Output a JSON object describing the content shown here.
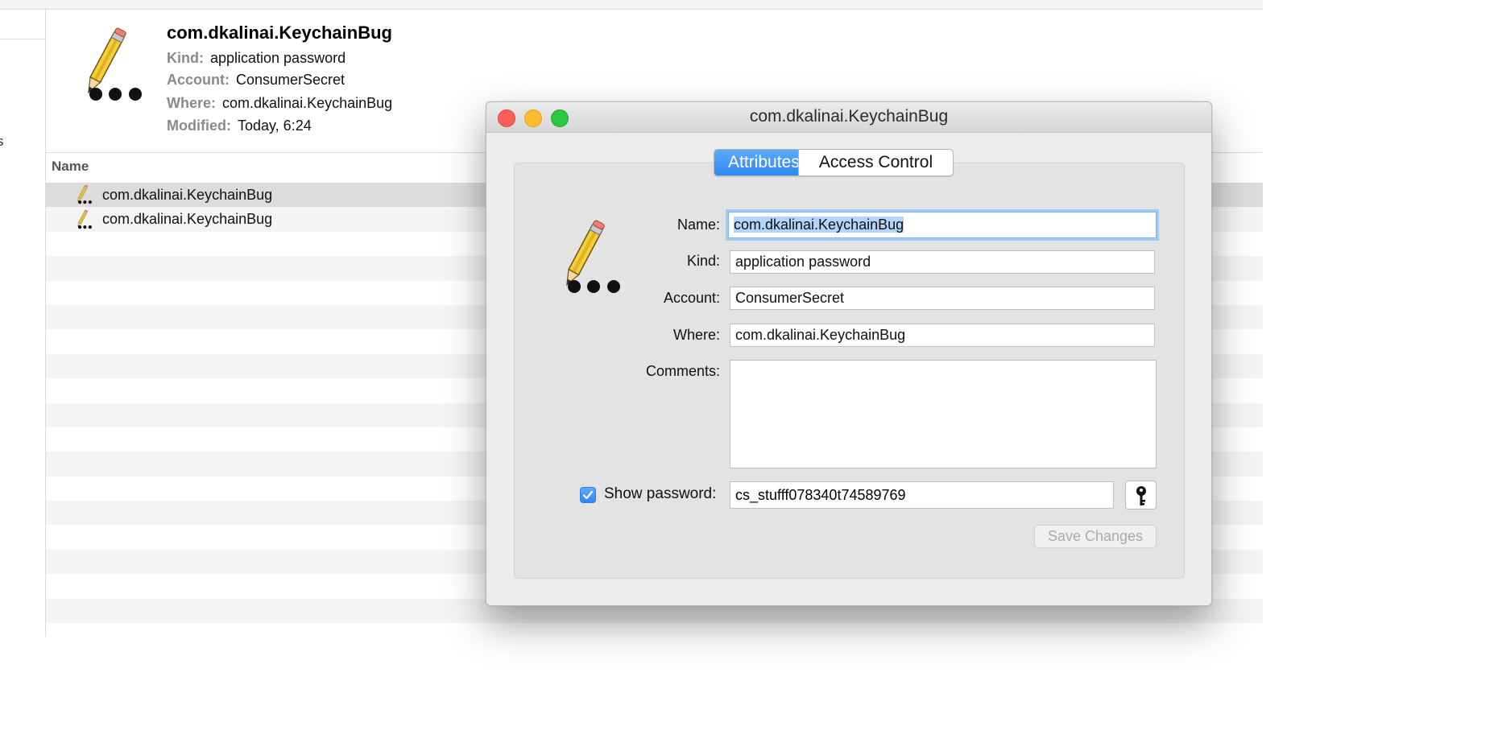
{
  "background": {
    "summary": {
      "title": "com.dkalinai.KeychainBug",
      "kind_label": "Kind:",
      "kind_value": "application password",
      "account_label": "Account:",
      "account_value": "ConsumerSecret",
      "where_label": "Where:",
      "where_value": "com.dkalinai.KeychainBug",
      "modified_label": "Modified:",
      "modified_value": "Today, 6:24"
    },
    "sidebar_partial_text": "s",
    "list": {
      "column_header": "Name",
      "rows": [
        {
          "name": "com.dkalinai.KeychainBug",
          "selected": true
        },
        {
          "name": "com.dkalinai.KeychainBug",
          "selected": false
        }
      ]
    }
  },
  "dialog": {
    "title": "com.dkalinai.KeychainBug",
    "tabs": [
      {
        "label": "Attributes",
        "active": true
      },
      {
        "label": "Access Control",
        "active": false
      }
    ],
    "form": {
      "name_label": "Name:",
      "name_value": "com.dkalinai.KeychainBug",
      "kind_label": "Kind:",
      "kind_value": "application password",
      "account_label": "Account:",
      "account_value": "ConsumerSecret",
      "where_label": "Where:",
      "where_value": "com.dkalinai.KeychainBug",
      "comments_label": "Comments:",
      "comments_value": "",
      "show_password_label": "Show password:",
      "show_password_checked": true,
      "password_value": "cs_stufff078340t74589769"
    },
    "key_button_icon": "key-icon",
    "save_label": "Save Changes",
    "save_enabled": false
  },
  "icons": {
    "item_icon": "pencil-password-icon",
    "close": "close-traffic-light",
    "minimize": "minimize-traffic-light",
    "zoom": "zoom-traffic-light"
  },
  "colors": {
    "accent": "#2d88f3",
    "selection_highlight": "#b3d5fd",
    "close_light": "#fc5f57",
    "minimize_light": "#fdbc2e",
    "zoom_light": "#29c83f"
  }
}
